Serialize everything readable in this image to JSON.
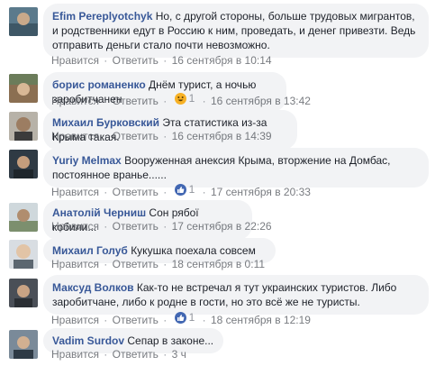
{
  "ui": {
    "like": "Нравится",
    "reply": "Ответить",
    "sep": "·"
  },
  "comments": [
    {
      "author": "Efim Pereplyotchyk",
      "text": "Но, с другой стороны, больше трудовых мигрантов, и родственники едут в Россию к ним, проведать, и денег привезти. Ведь отправить деньги стало почти невозможно.",
      "time": "16 сентября в 10:14"
    },
    {
      "author": "борис романенко",
      "text": "Днём турист, а ночью заробитчанен",
      "reaction_icon": "haha-icon",
      "reaction_count": "1",
      "time": "16 сентября в 13:42"
    },
    {
      "author": "Михаил Бурковский",
      "text": "Эта статистика из-за Крыма такая.",
      "time": "16 сентября в 14:39"
    },
    {
      "author": "Yuriy Melmax",
      "text": "Вооруженная анексия Крыма, вторжение на Домбас, постоянное вранье......",
      "reaction_icon": "like-icon",
      "reaction_count": "1",
      "time": "17 сентября в 20:33"
    },
    {
      "author": "Анатолій Черниш",
      "text": "Сон рябої кобили...",
      "time": "17 сентября в 22:26"
    },
    {
      "author": "Михаил Голуб",
      "text": "Кукушка поехала совсем",
      "time": "18 сентября в 0:11"
    },
    {
      "author": "Максуд Волков",
      "text": "Как-то не встречал я тут украинских туристов. Либо заробитчане, либо к родне в гости, но это всё же не туристы.",
      "reaction_icon": "like-icon",
      "reaction_count": "1",
      "time": "18 сентября в 12:19"
    },
    {
      "author": "Vadim Surdov",
      "text": "Сепар в законе...",
      "time": "3 ч"
    }
  ]
}
